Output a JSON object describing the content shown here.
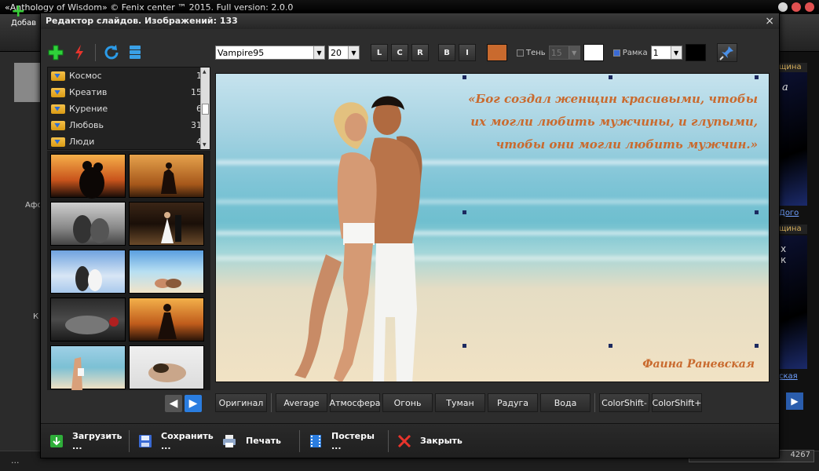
{
  "app": {
    "title": "«Anthology of Wisdom» © Fenix center ™ 2015. Full version: 2.0.0",
    "add_label": "Добав",
    "left_label_1": "Афо",
    "left_label_2": "К",
    "status_left": "...",
    "status_counter": "4267",
    "right_tag_1": "щина",
    "right_tag_2": "щина",
    "right_link_1": "Дого",
    "right_link_2": "ская",
    "right_text_1": "а",
    "right_text_2": "х\nк"
  },
  "dialog": {
    "title": "Редактор слайдов. Изображений: 133",
    "close_glyph": "×"
  },
  "left_toolbar": {
    "icons": [
      "add-icon",
      "flash-icon",
      "refresh-icon",
      "database-icon"
    ]
  },
  "folders": [
    {
      "name": "Космос",
      "count": "1"
    },
    {
      "name": "Креатив",
      "count": "15"
    },
    {
      "name": "Курение",
      "count": "6"
    },
    {
      "name": "Любовь",
      "count": "31"
    },
    {
      "name": "Люди",
      "count": "4"
    }
  ],
  "format": {
    "font_name": "Vampire95",
    "font_size": "20",
    "align_left": "L",
    "align_center": "C",
    "align_right": "R",
    "bold": "B",
    "italic": "I",
    "text_color": "#c96a2e",
    "shadow_label": "Тень",
    "shadow_value": "15",
    "shadow_color": "#ffffff",
    "frame_label": "Рамка",
    "frame_value": "1",
    "frame_color": "#000000"
  },
  "slide": {
    "quote": "«Бог создал женщин красивыми, чтобы их могли любить мужчины, и глупыми, чтобы они могли любить мужчин.»",
    "author": "Фаина Раневская"
  },
  "effects": {
    "original": "Оригинал",
    "items": [
      "Average",
      "Атмосфера",
      "Огонь",
      "Туман",
      "Радуга",
      "Вода"
    ],
    "shift_minus": "ColorShift-",
    "shift_plus": "ColorShift+"
  },
  "bottom": {
    "load": "Загрузить ...",
    "save": "Сохранить ...",
    "print": "Печать",
    "posters": "Постеры ...",
    "close": "Закрыть"
  }
}
